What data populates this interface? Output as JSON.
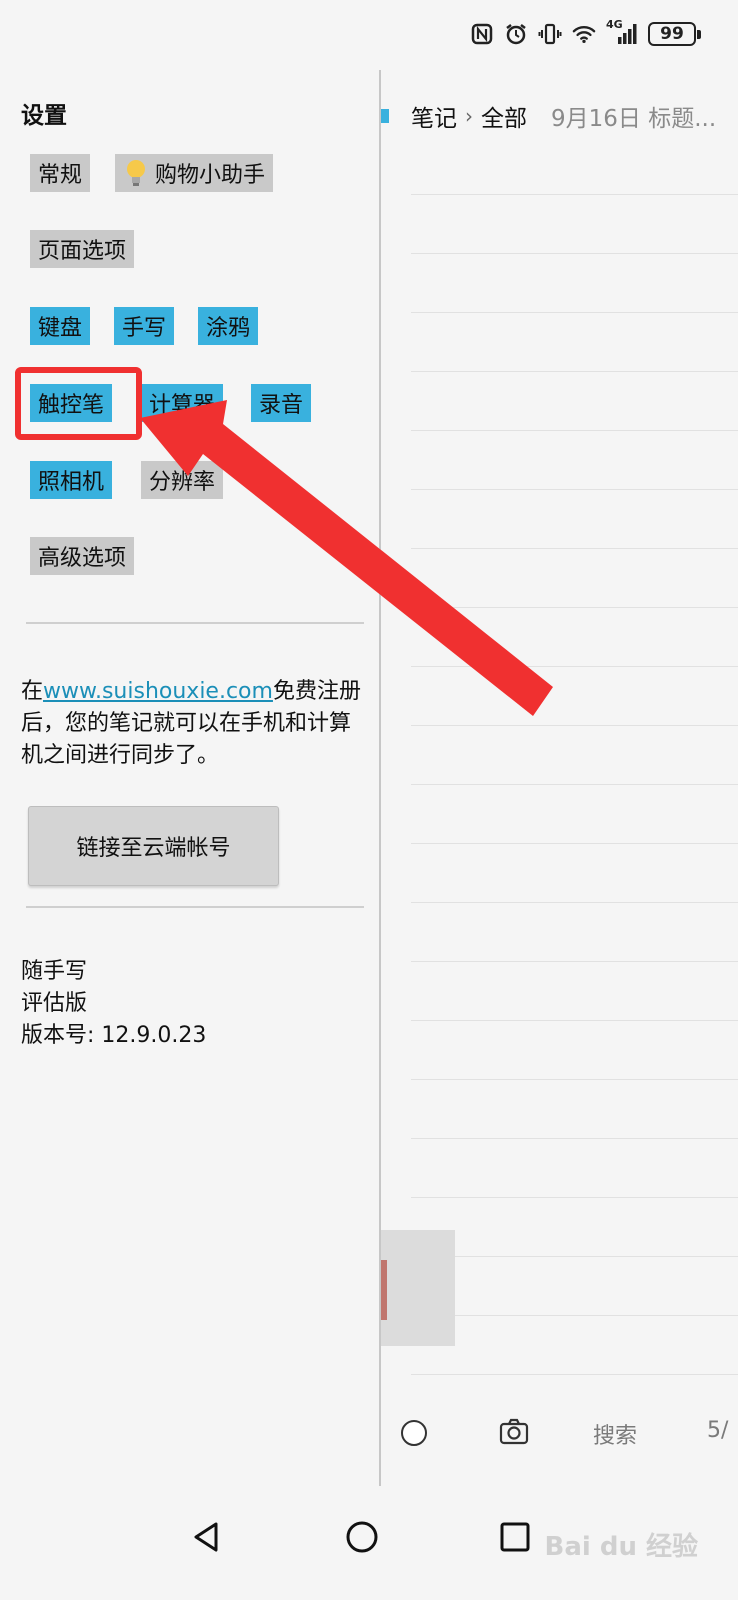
{
  "status_bar": {
    "icons": [
      "nfc-icon",
      "alarm-icon",
      "vibrate-icon",
      "wifi-icon",
      "signal-4g-icon"
    ],
    "network_label": "4G",
    "battery_level": "99"
  },
  "settings": {
    "title": "设置",
    "chips": {
      "general": "常规",
      "shopping": "购物小助手",
      "page_options": "页面选项",
      "keyboard": "键盘",
      "handwriting": "手写",
      "doodle": "涂鸦",
      "stylus": "触控笔",
      "calculator": "计算器",
      "recording": "录音",
      "camera": "照相机",
      "resolution": "分辨率",
      "advanced": "高级选项"
    },
    "info": {
      "prefix": "在",
      "link": "www.suishouxie.com",
      "suffix": "免费注册后，您的笔记就可以在手机和计算机之间进行同步了。"
    },
    "link_button": "链接至云端帐号",
    "version": {
      "app_name": "随手写",
      "edition": "评估版",
      "version_line": "版本号: 12.9.0.23"
    }
  },
  "notes": {
    "breadcrumb_root": "笔记",
    "breadcrumb_sep": "›",
    "breadcrumb_current": "全部",
    "date_title": "9月16日 标题...",
    "toolbar": {
      "search_label": "搜索",
      "page_indicator": "5/"
    }
  },
  "watermark": "Bai du 经验",
  "colors": {
    "chip_gray": "#c9c9c9",
    "chip_blue": "#39b1de",
    "link": "#1b8fb8",
    "annotation_red": "#f03030"
  }
}
